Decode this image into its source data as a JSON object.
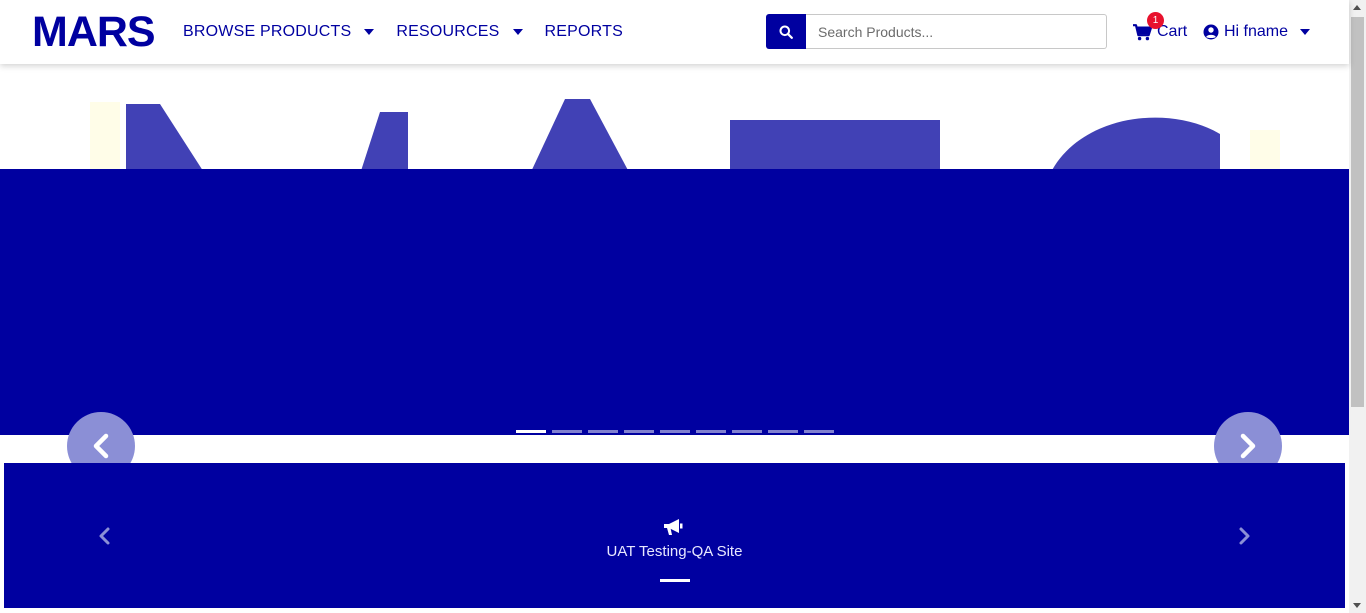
{
  "brand": {
    "logo_text": "MARS",
    "color": "#0000a0"
  },
  "nav": {
    "items": [
      {
        "label": "BROWSE PRODUCTS",
        "has_dropdown": true
      },
      {
        "label": "RESOURCES",
        "has_dropdown": true
      },
      {
        "label": "REPORTS",
        "has_dropdown": false
      }
    ]
  },
  "search": {
    "placeholder": "Search Products...",
    "value": "",
    "icon": "search-icon"
  },
  "cart": {
    "label": "Cart",
    "count": "1",
    "icon": "shopping-cart-icon",
    "badge_color": "#e8112d"
  },
  "user": {
    "label": "Hi fname",
    "icon": "user-circle-icon"
  },
  "carousel": {
    "slide_count": 9,
    "active_index": 0,
    "prev_icon": "chevron-left-icon",
    "next_icon": "chevron-right-icon"
  },
  "announcement": {
    "text": "UAT Testing-QA Site",
    "icon": "bullhorn-icon",
    "background": "#0000a0"
  }
}
